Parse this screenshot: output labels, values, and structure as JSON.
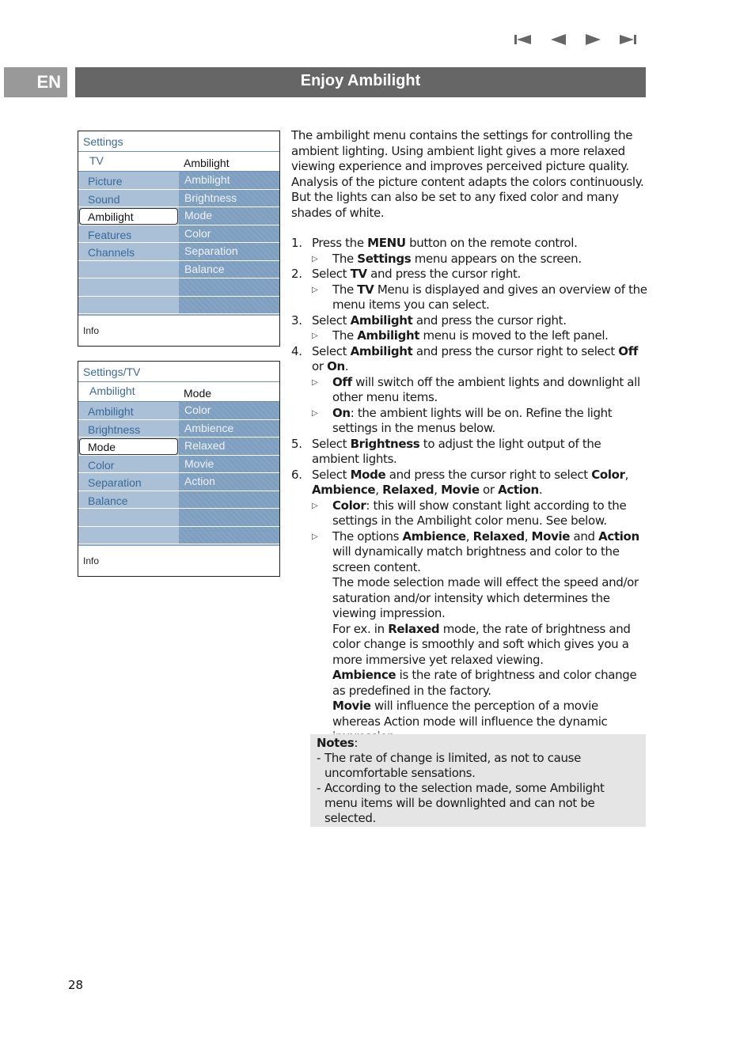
{
  "nav": {
    "buttons": [
      {
        "name": "first-page",
        "icon": "skip-to-start-icon"
      },
      {
        "name": "previous-page",
        "icon": "triangle-left-icon"
      },
      {
        "name": "next-page",
        "icon": "triangle-right-icon"
      },
      {
        "name": "last-page",
        "icon": "skip-to-end-icon"
      }
    ],
    "color": "#666666"
  },
  "header": {
    "language": "EN",
    "title": "Enjoy Ambilight",
    "language_bg": "#999999",
    "title_bg": "#666666"
  },
  "menu1": {
    "breadcrumb": "Settings",
    "left_title": "TV",
    "right_title": "Ambilight",
    "rows": [
      {
        "left": "Picture",
        "right": "Ambilight",
        "selected": false
      },
      {
        "left": "Sound",
        "right": "Brightness",
        "selected": false
      },
      {
        "left": "Ambilight",
        "right": "Mode",
        "selected": true
      },
      {
        "left": "Features",
        "right": "Color",
        "selected": false
      },
      {
        "left": "Channels",
        "right": "Separation",
        "selected": false
      },
      {
        "left": "",
        "right": "Balance",
        "selected": false
      },
      {
        "left": "",
        "right": "",
        "selected": false
      },
      {
        "left": "",
        "right": "",
        "selected": false
      }
    ],
    "info": "Info"
  },
  "menu2": {
    "breadcrumb": "Settings/TV",
    "left_title": "Ambilight",
    "right_title": "Mode",
    "rows": [
      {
        "left": "Ambilight",
        "right": "Color",
        "selected": false
      },
      {
        "left": "Brightness",
        "right": "Ambience",
        "selected": false
      },
      {
        "left": "Mode",
        "right": "Relaxed",
        "selected": true
      },
      {
        "left": "Color",
        "right": "Movie",
        "selected": false
      },
      {
        "left": "Separation",
        "right": "Action",
        "selected": false
      },
      {
        "left": "Balance",
        "right": "",
        "selected": false
      },
      {
        "left": "",
        "right": "",
        "selected": false
      },
      {
        "left": "",
        "right": "",
        "selected": false
      }
    ],
    "info": "Info"
  },
  "intro": "The ambilight menu contains the settings for controlling the ambient lighting. Using ambient light gives a more relaxed viewing experience and improves perceived picture quality. Analysis of the picture content adapts the colors continuously. But the lights can also be set to any fixed color and many shades of white.",
  "steps": [
    {
      "num": "1.",
      "parts": [
        [
          "Press the ",
          false
        ],
        [
          "MENU",
          true
        ],
        [
          " button on the remote control.",
          false
        ]
      ],
      "subs": [
        {
          "parts": [
            [
              "The ",
              false
            ],
            [
              "Settings",
              true
            ],
            [
              " menu appears on the screen.",
              false
            ]
          ]
        }
      ]
    },
    {
      "num": "2.",
      "parts": [
        [
          "Select ",
          false
        ],
        [
          "TV",
          true
        ],
        [
          " and press the cursor right.",
          false
        ]
      ],
      "subs": [
        {
          "parts": [
            [
              "The ",
              false
            ],
            [
              "TV",
              true
            ],
            [
              " Menu is displayed and gives an overview of the menu items you can select.",
              false
            ]
          ]
        }
      ]
    },
    {
      "num": "3.",
      "parts": [
        [
          "Select ",
          false
        ],
        [
          "Ambilight",
          true
        ],
        [
          " and press the cursor right.",
          false
        ]
      ],
      "subs": [
        {
          "parts": [
            [
              "The ",
              false
            ],
            [
              "Ambilight",
              true
            ],
            [
              " menu is moved to the left panel.",
              false
            ]
          ]
        }
      ]
    },
    {
      "num": "4.",
      "parts": [
        [
          "Select ",
          false
        ],
        [
          "Ambilight",
          true
        ],
        [
          " and press the cursor right to select ",
          false
        ],
        [
          "Off",
          true
        ],
        [
          " or ",
          false
        ],
        [
          "On",
          true
        ],
        [
          ".",
          false
        ]
      ],
      "subs": [
        {
          "parts": [
            [
              "Off",
              true
            ],
            [
              " will switch off the ambient lights and downlight all other menu items.",
              false
            ]
          ]
        },
        {
          "parts": [
            [
              "On",
              true
            ],
            [
              ": the ambient lights will be on. Refine the light settings in the menus below.",
              false
            ]
          ]
        }
      ]
    },
    {
      "num": "5.",
      "parts": [
        [
          "Select ",
          false
        ],
        [
          "Brightness",
          true
        ],
        [
          " to adjust the light output of the ambient lights.",
          false
        ]
      ],
      "subs": []
    },
    {
      "num": "6.",
      "parts": [
        [
          "Select ",
          false
        ],
        [
          "Mode",
          true
        ],
        [
          " and press the cursor right to select ",
          false
        ],
        [
          "Color",
          true
        ],
        [
          ", ",
          false
        ],
        [
          "Ambience",
          true
        ],
        [
          ", ",
          false
        ],
        [
          "Relaxed",
          true
        ],
        [
          ", ",
          false
        ],
        [
          "Movie",
          true
        ],
        [
          " or ",
          false
        ],
        [
          "Action",
          true
        ],
        [
          ".",
          false
        ]
      ],
      "subs": [
        {
          "parts": [
            [
              "Color",
              true
            ],
            [
              ": this will show constant light according to the settings in the Ambilight color menu. See below.",
              false
            ]
          ]
        },
        {
          "parts": [
            [
              "The options ",
              false
            ],
            [
              "Ambience",
              true
            ],
            [
              ", ",
              false
            ],
            [
              "Relaxed",
              true
            ],
            [
              ", ",
              false
            ],
            [
              "Movie",
              true
            ],
            [
              " and ",
              false
            ],
            [
              "Action",
              true
            ],
            [
              " will dynamically match brightness and color to the screen content.",
              false
            ]
          ]
        }
      ],
      "extra": [
        {
          "parts": [
            [
              "The mode selection made will effect the speed and/or saturation and/or intensity which determines the viewing impression.",
              false
            ]
          ]
        },
        {
          "parts": [
            [
              "For ex. in ",
              false
            ],
            [
              "Relaxed",
              true
            ],
            [
              " mode, the rate of brightness and color change is smoothly and soft which gives you a more immersive yet relaxed viewing.",
              false
            ]
          ]
        },
        {
          "parts": [
            [
              "Ambience",
              true
            ],
            [
              " is the rate of brightness and color change as predefined in the factory.",
              false
            ]
          ]
        },
        {
          "parts": [
            [
              "Movie",
              true
            ],
            [
              " will influence the perception of a movie whereas Action mode will influence the dynamic impression.",
              false
            ]
          ]
        }
      ]
    }
  ],
  "notes": {
    "title": "Notes",
    "items": [
      "The rate of change is limited, as not to cause uncomfortable sensations.",
      "According to the selection made, some Ambilight menu items will be downlighted and can not be selected."
    ],
    "bg": "#e5e5e5"
  },
  "page_number": "28"
}
